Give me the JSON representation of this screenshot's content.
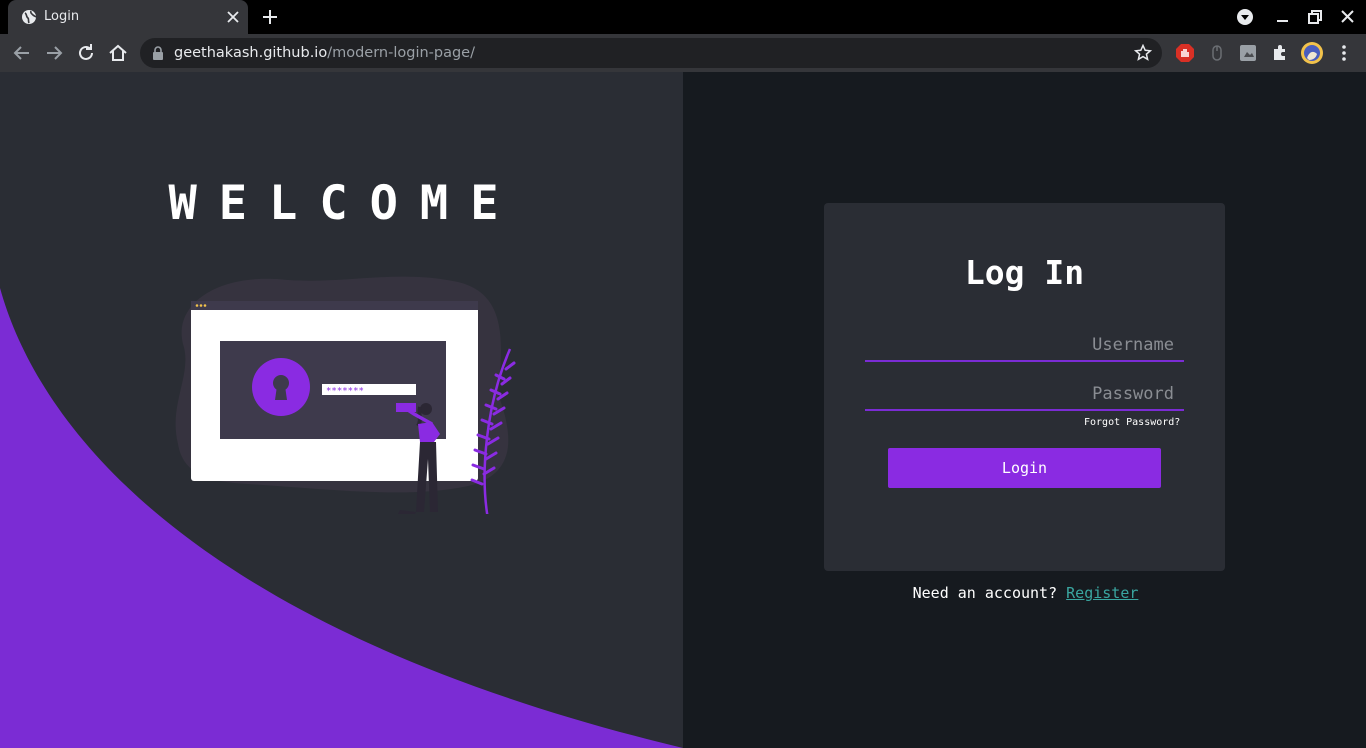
{
  "browser": {
    "tab_title": "Login",
    "url_host": "geethakash.github.io",
    "url_path": "/modern-login-page/",
    "icons": [
      "globe-icon",
      "close-icon",
      "plus-icon",
      "media-icon",
      "minimize-icon",
      "restore-icon",
      "close-window-icon",
      "back-icon",
      "forward-icon",
      "reload-icon",
      "home-icon",
      "lock-icon",
      "star-icon",
      "extension-icons",
      "puzzle-icon",
      "avatar",
      "kebab-menu-icon"
    ]
  },
  "hero": {
    "title": "WELCOME",
    "illustration_password_mask": "*******",
    "colors": {
      "accent": "#7b2cd4",
      "pane": "#2a2d34"
    }
  },
  "login": {
    "title": "Log In",
    "username_placeholder": "Username",
    "password_placeholder": "Password",
    "forgot_label": "Forgot Password?",
    "submit_label": "Login",
    "register_prompt": "Need an account?",
    "register_label": "Register",
    "colors": {
      "accent": "#8a2be2",
      "link": "#3aa6a0",
      "background": "#161a1f"
    }
  }
}
